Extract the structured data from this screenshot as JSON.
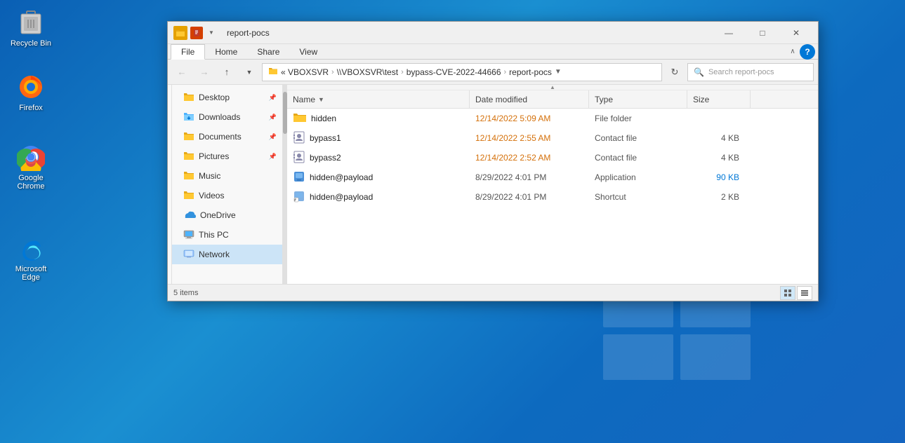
{
  "desktop": {
    "icons": [
      {
        "id": "recycle-bin",
        "label": "Recycle Bin",
        "icon": "recycle"
      },
      {
        "id": "firefox",
        "label": "Firefox",
        "icon": "firefox"
      },
      {
        "id": "chrome",
        "label": "Google Chrome",
        "icon": "chrome"
      },
      {
        "id": "edge",
        "label": "Microsoft Edge",
        "icon": "edge"
      }
    ]
  },
  "window": {
    "title": "report-pocs",
    "titlebar": {
      "icon_color": "#e6a817",
      "minimize": "—",
      "maximize": "□",
      "close": "✕"
    },
    "ribbon": {
      "tabs": [
        "File",
        "Home",
        "Share",
        "View"
      ]
    },
    "address": {
      "breadcrumb": "« VBOXSVR  >  \\\\VBOXSVR\\test  >  bypass-CVE-2022-44666  >  report-pocs",
      "parts": [
        "« VBOXSVR",
        "\\\\VBOXSVR\\test",
        "bypass-CVE-2022-44666",
        "report-pocs"
      ],
      "search_placeholder": "Search report-pocs"
    },
    "sidebar": {
      "items": [
        {
          "id": "desktop",
          "label": "Desktop",
          "pin": true
        },
        {
          "id": "downloads",
          "label": "Downloads",
          "pin": true
        },
        {
          "id": "documents",
          "label": "Documents",
          "pin": true
        },
        {
          "id": "pictures",
          "label": "Pictures",
          "pin": true
        },
        {
          "id": "music",
          "label": "Music"
        },
        {
          "id": "videos",
          "label": "Videos"
        },
        {
          "id": "onedrive",
          "label": "OneDrive"
        },
        {
          "id": "thispc",
          "label": "This PC"
        },
        {
          "id": "network",
          "label": "Network",
          "active": true
        }
      ]
    },
    "columns": {
      "name": "Name",
      "date_modified": "Date modified",
      "type": "Type",
      "size": "Size"
    },
    "files": [
      {
        "id": "hidden-folder",
        "name": "hidden",
        "date_modified": "12/14/2022 5:09 AM",
        "type": "File folder",
        "size": "",
        "icon": "folder",
        "date_color": "orange"
      },
      {
        "id": "bypass1",
        "name": "bypass1",
        "date_modified": "12/14/2022 2:55 AM",
        "type": "Contact file",
        "size": "4 KB",
        "icon": "contact",
        "date_color": "orange"
      },
      {
        "id": "bypass2",
        "name": "bypass2",
        "date_modified": "12/14/2022 2:52 AM",
        "type": "Contact file",
        "size": "4 KB",
        "icon": "contact",
        "date_color": "orange"
      },
      {
        "id": "hidden-payload-app",
        "name": "hidden@payload",
        "date_modified": "8/29/2022 4:01 PM",
        "type": "Application",
        "size": "90 KB",
        "icon": "app",
        "date_color": "normal",
        "size_color": "blue"
      },
      {
        "id": "hidden-payload-shortcut",
        "name": "hidden@payload",
        "date_modified": "8/29/2022 4:01 PM",
        "type": "Shortcut",
        "size": "2 KB",
        "icon": "shortcut",
        "date_color": "normal"
      }
    ],
    "status": {
      "items_count": "5 items"
    }
  }
}
